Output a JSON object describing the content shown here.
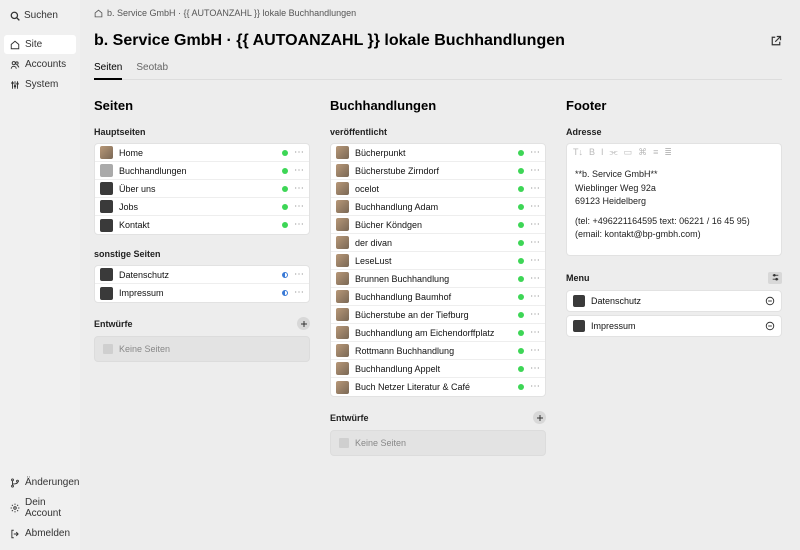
{
  "sidebar": {
    "search_label": "Suchen",
    "nav": [
      {
        "icon": "home-icon",
        "label": "Site",
        "active": true
      },
      {
        "icon": "users-icon",
        "label": "Accounts",
        "active": false
      },
      {
        "icon": "sliders-icon",
        "label": "System",
        "active": false
      }
    ],
    "bottom": [
      {
        "icon": "branch-icon",
        "label": "Änderungen"
      },
      {
        "icon": "gear-icon",
        "label": "Dein Account"
      },
      {
        "icon": "logout-icon",
        "label": "Abmelden"
      }
    ]
  },
  "breadcrumbs": {
    "home_label": "",
    "text": "b. Service GmbH · {{ AUTOANZAHL }} lokale Buchhandlungen"
  },
  "page_title": "b. Service GmbH · {{ AUTOANZAHL }} lokale Buchhandlungen",
  "tabs": [
    {
      "label": "Seiten",
      "active": true
    },
    {
      "label": "Seotab",
      "active": false
    }
  ],
  "columns": {
    "pages": {
      "title": "Seiten",
      "main_label": "Hauptseiten",
      "main_items": [
        {
          "label": "Home",
          "status": "green"
        },
        {
          "label": "Buchhandlungen",
          "status": "green"
        },
        {
          "label": "Über uns",
          "status": "green"
        },
        {
          "label": "Jobs",
          "status": "green"
        },
        {
          "label": "Kontakt",
          "status": "green"
        }
      ],
      "other_label": "sonstige Seiten",
      "other_items": [
        {
          "label": "Datenschutz",
          "status": "half"
        },
        {
          "label": "Impressum",
          "status": "half"
        }
      ],
      "drafts_label": "Entwürfe",
      "drafts_empty": "Keine Seiten"
    },
    "bookstores": {
      "title": "Buchhandlungen",
      "published_label": "veröffentlicht",
      "items": [
        {
          "label": "Bücherpunkt"
        },
        {
          "label": "Bücherstube Zirndorf"
        },
        {
          "label": "ocelot"
        },
        {
          "label": "Buchhandlung Adam"
        },
        {
          "label": "Bücher Köndgen"
        },
        {
          "label": "der divan"
        },
        {
          "label": "LeseLust"
        },
        {
          "label": "Brunnen Buchhandlung"
        },
        {
          "label": "Buchhandlung Baumhof"
        },
        {
          "label": "Bücherstube an der Tiefburg"
        },
        {
          "label": "Buchhandlung am Eichendorffplatz"
        },
        {
          "label": "Rottmann Buchhandlung"
        },
        {
          "label": "Buchhandlung Appelt"
        },
        {
          "label": "Buch Netzer Literatur & Café"
        }
      ],
      "drafts_label": "Entwürfe",
      "drafts_empty": "Keine Seiten"
    },
    "footer": {
      "title": "Footer",
      "address_label": "Adresse",
      "address_lines": {
        "l1": "**b. Service GmbH**",
        "l2": "Wieblinger Weg 92a",
        "l3": "69123 Heidelberg",
        "l4": "(tel: +496221164595 text: 06221 / 16 45 95)",
        "l5": "(email: kontakt@bp-gmbh.com)"
      },
      "menu_label": "Menu",
      "menu_items": [
        {
          "label": "Datenschutz"
        },
        {
          "label": "Impressum"
        }
      ]
    }
  }
}
